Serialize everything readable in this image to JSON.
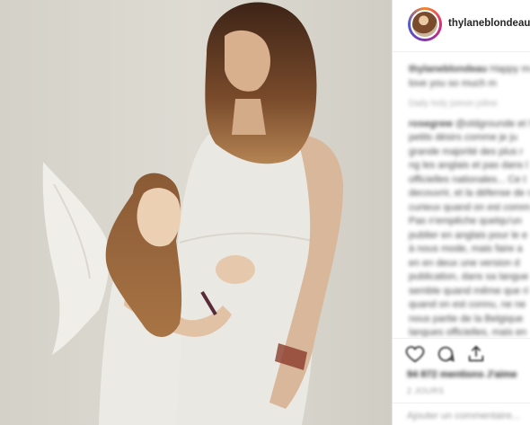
{
  "post": {
    "username": "thylaneblondeau",
    "photo_alt": "",
    "comments": [
      {
        "user": "thylaneblondeau",
        "lines": [
          "Happy mo",
          "love you so much m"
        ]
      },
      {
        "user": "",
        "lines": [
          "Daily holy joinon joline"
        ]
      },
      {
        "user": "rosegrew",
        "lines": [
          "@oldgrounde et Mo",
          "petits désirs comme je ju",
          "grande majorité des plus r",
          "ng les anglais et pas dans l",
          "officielles nationales... Ce t",
          "decouvrir, et la défense de s",
          "curieux quand on est comme",
          "Pas n'empêche quelqu'un",
          "publier en anglais pour le e",
          "à nous mode, mais faire a",
          "en en deux une version d",
          "publication, dans sa langue",
          "semble quand même que ri",
          "quand on est connu, ne ne",
          "nous partie de la Belgique",
          "langues officielles, mais en"
        ]
      }
    ],
    "likes": "94 872 mentions J'aime",
    "date": "2 JOURS",
    "add_comment_placeholder": "Ajouter un commentaire..."
  },
  "icons": [
    "heart-icon",
    "comment-icon",
    "share-icon"
  ],
  "colors": {
    "text": "#262626",
    "muted": "#999999",
    "border": "#efefef",
    "background": "#ffffff"
  }
}
